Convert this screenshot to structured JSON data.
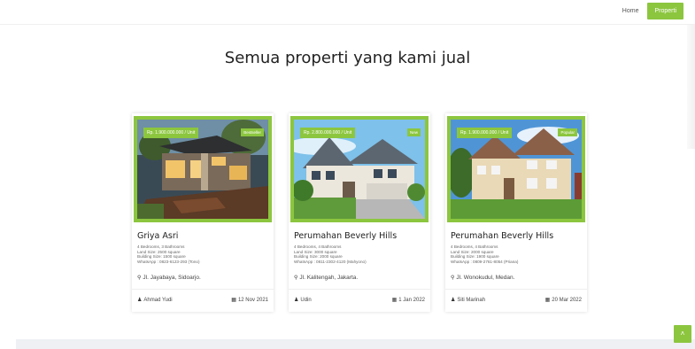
{
  "nav": {
    "home": "Home",
    "properti": "Properti"
  },
  "heading": "Semua properti yang kami jual",
  "accent": "#8cc63f",
  "cards": [
    {
      "price": "Rp. 1.900.000.000 / Unit",
      "status": "Bestseller",
      "title": "Griya Asri",
      "specs": [
        "4 Bedrooms, 3 Bathrooms",
        "Land Size: 2500 square",
        "Building Size: 1500 square",
        "WhatsApp : 0823-6123-293 (Tono)"
      ],
      "location": "Jl. Jayabaya, Sidoarjo.",
      "author": "Ahmad Yudi",
      "date": "12 Nov 2021"
    },
    {
      "price": "Rp. 2.800.000.000 / Unit",
      "status": "New",
      "title": "Perumahan Beverly Hills",
      "specs": [
        "4 Bedrooms, 4 Bathrooms",
        "Land Size: 3000 square",
        "Building Size: 2000 square",
        "WhatsApp : 0811-2302-4120 (Mahyono)"
      ],
      "location": "Jl. Kalitengah, Jakarta.",
      "author": "Udin",
      "date": "1 Jan 2022"
    },
    {
      "price": "Rp. 1.900.000.000 / Unit",
      "status": "Popular",
      "title": "Perumahan Beverly Hills",
      "specs": [
        "4 Bedrooms, 4 Bathrooms",
        "Land Size: 2000 square",
        "Building Size: 1900 square",
        "WhatsApp : 0809-2761-8054 (Priana)"
      ],
      "location": "Jl. Wonokudul, Medan.",
      "author": "Siti Marinah",
      "date": "20 Mar 2022"
    }
  ],
  "icons": {
    "location": "location-pin-icon",
    "author": "user-icon",
    "date": "calendar-icon",
    "top": "chevron-up-icon"
  }
}
